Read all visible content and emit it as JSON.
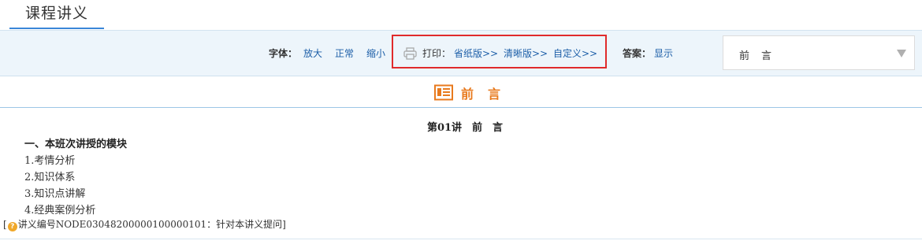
{
  "header": {
    "tab_title": "课程讲义"
  },
  "toolbar": {
    "font_label": "字体：",
    "font_enlarge": "放大",
    "font_normal": "正常",
    "font_shrink": "缩小",
    "print_label": "打印：",
    "print_paper_saving": "省纸版>>",
    "print_clear": "清晰版>>",
    "print_custom": "自定义>>",
    "answer_label": "答案：",
    "answer_show": "显示",
    "chapter_select_value": "前　言"
  },
  "section": {
    "title": "前　言"
  },
  "content": {
    "lecture_title": "第01讲　前　言",
    "heading": "一、本班次讲授的模块",
    "items": [
      "1.考情分析",
      "2.知识体系",
      "3.知识点讲解",
      "4.经典案例分析"
    ],
    "ref_prefix": "[",
    "ref_text": "讲义编号NODE03048200000100000101：针对本讲义提问]"
  },
  "colors": {
    "accent_blue": "#3a86d8",
    "link_blue": "#1d5fa8",
    "highlight_red": "#e02b2b",
    "section_orange": "#e87a1e"
  }
}
